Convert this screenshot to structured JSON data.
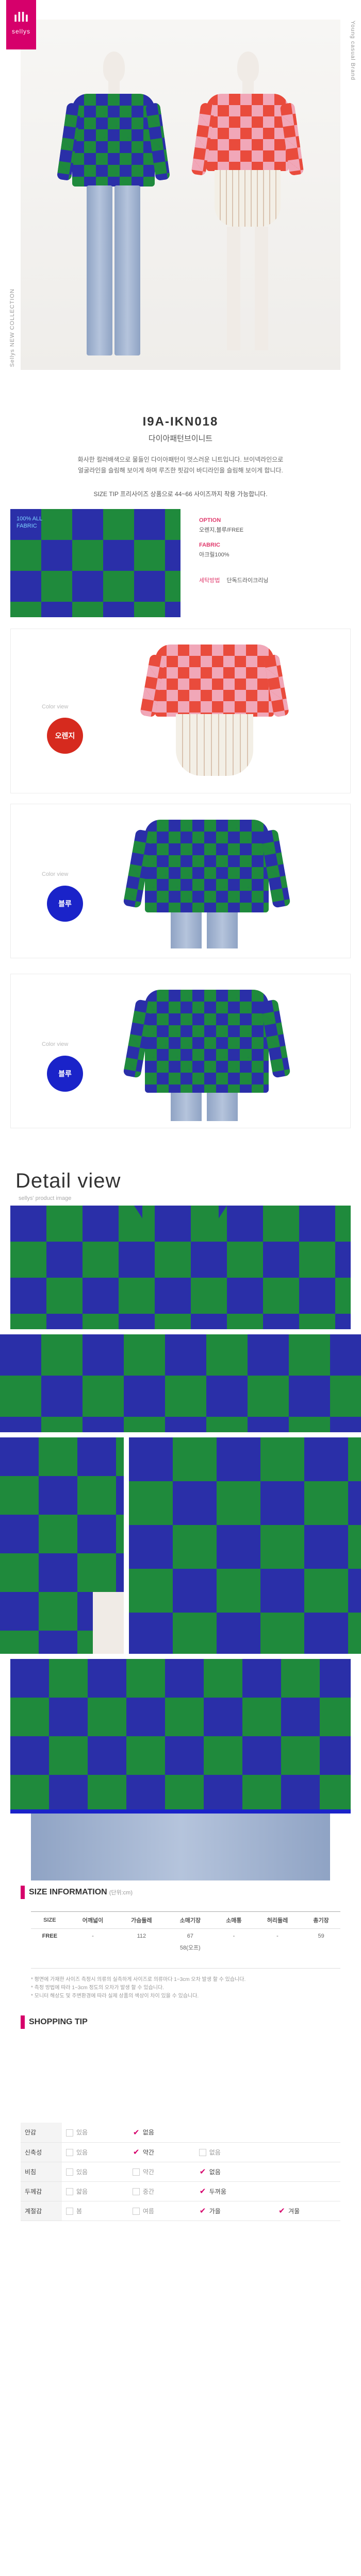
{
  "brand": {
    "logo_mark": "ıllı",
    "logo_text": "sellys",
    "color": "#d6006b"
  },
  "hero": {
    "vertical_left": "Sellys NEW COLLECTION",
    "vertical_right": "Young casual Brand"
  },
  "product": {
    "code": "I9A-IKN018",
    "name": "다이아패턴브이니트",
    "description_lines": [
      "화사한 컬러배색으로 물들인 다이아패턴이 멋스러운 니트입니다. 브이넥라인으로",
      "얼굴라인을 슬림해 보이게 하며 루즈한 핏감이 바디라인을 슬림해 보이게 합니다."
    ],
    "size_tip": "SIZE TIP 프리사이즈 상품으로 44~66 사이즈까지 착용 가능합니다.",
    "fabric_label_line1": "100% ALL",
    "fabric_label_line2": "FABRIC",
    "specs": [
      {
        "key": "OPTION",
        "value": "오렌지,블루/FREE"
      },
      {
        "key": "FABRIC",
        "value": "아크릴100%"
      },
      {
        "key": "세탁방법",
        "value": "단독드라이크리닝"
      }
    ]
  },
  "color_views": [
    {
      "label": "Color view",
      "name": "오렌지",
      "color": "#d62a1e"
    },
    {
      "label": "Color view",
      "name": "블루",
      "color": "#1a23c9"
    },
    {
      "label": "Color view",
      "name": "블루",
      "color": "#1a23c9"
    }
  ],
  "detail": {
    "title": "Detail view",
    "subtitle": "sellys' product image"
  },
  "size_info": {
    "title": "SIZE INFORMATION",
    "unit": "(단위:cm)",
    "columns": [
      "SIZE",
      "어깨넓이",
      "가슴둘레",
      "소매기장",
      "소매통",
      "허리둘레",
      "총기장"
    ],
    "rows": [
      [
        "FREE",
        "-",
        "112",
        "67",
        "-",
        "-",
        "59"
      ]
    ],
    "sub_note": "58(오프)",
    "notes": [
      "* 평면에 가재한 사이즈 측정시 의류의 실측하게 사이즈로 의류마다 1~3cm 오차 발생 할 수 있습니다.",
      "* 측정 방법에 따라 1~3cm 정도의 오차가 발생 할 수 있습니다.",
      "* 모니터 해상도 및 주변환경에 따라 실제 상품의 색상이 차이 있을 수 있습니다."
    ]
  },
  "shopping_tip": {
    "title": "SHOPPING TIP",
    "rows": [
      {
        "label": "안감",
        "options": [
          {
            "text": "있음",
            "on": false
          },
          {
            "text": "없음",
            "on": true
          },
          {
            "text": "",
            "on": false
          },
          {
            "text": "",
            "on": false
          }
        ]
      },
      {
        "label": "신축성",
        "options": [
          {
            "text": "있음",
            "on": false
          },
          {
            "text": "약간",
            "on": true
          },
          {
            "text": "없음",
            "on": false
          },
          {
            "text": "",
            "on": false
          }
        ]
      },
      {
        "label": "비침",
        "options": [
          {
            "text": "있음",
            "on": false
          },
          {
            "text": "약간",
            "on": false
          },
          {
            "text": "없음",
            "on": true
          },
          {
            "text": "",
            "on": false
          }
        ]
      },
      {
        "label": "두께감",
        "options": [
          {
            "text": "얇음",
            "on": false
          },
          {
            "text": "중간",
            "on": false
          },
          {
            "text": "두꺼움",
            "on": true
          },
          {
            "text": "",
            "on": false
          }
        ]
      },
      {
        "label": "계절감",
        "options": [
          {
            "text": "봄",
            "on": false
          },
          {
            "text": "여름",
            "on": false
          },
          {
            "text": "가을",
            "on": true
          },
          {
            "text": "겨울",
            "on": true
          }
        ]
      }
    ]
  }
}
